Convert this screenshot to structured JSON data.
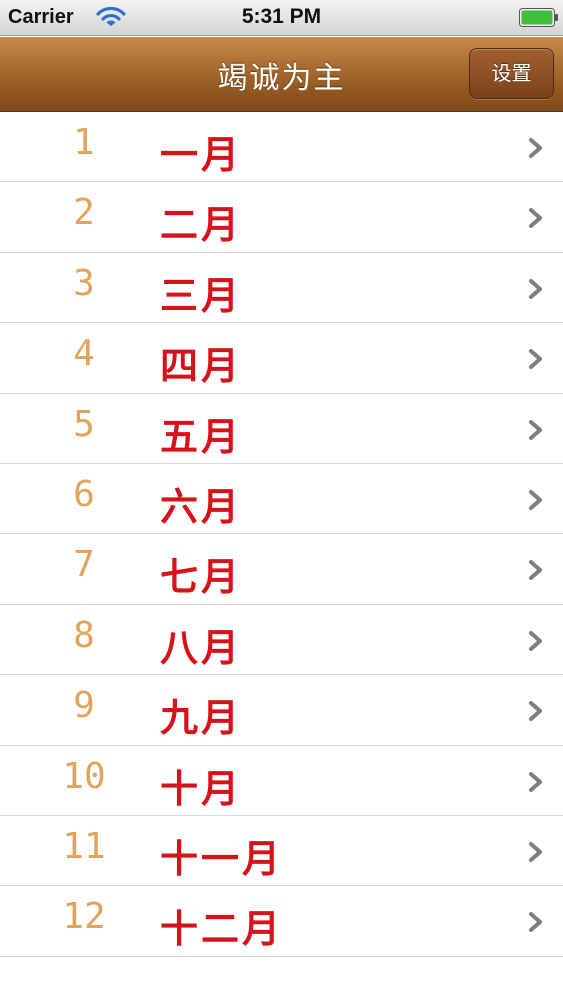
{
  "status_bar": {
    "carrier": "Carrier",
    "time": "5:31 PM"
  },
  "nav": {
    "title": "竭诚为主",
    "settings_label": "设置"
  },
  "colors": {
    "nav_brown": "#a7692e",
    "number_orange": "#e2a35c",
    "month_red": "#d6121a",
    "chevron_gray": "#7d7d7d"
  },
  "months": [
    {
      "num": "1",
      "label": "一月"
    },
    {
      "num": "2",
      "label": "二月"
    },
    {
      "num": "3",
      "label": "三月"
    },
    {
      "num": "4",
      "label": "四月"
    },
    {
      "num": "5",
      "label": "五月"
    },
    {
      "num": "6",
      "label": "六月"
    },
    {
      "num": "7",
      "label": "七月"
    },
    {
      "num": "8",
      "label": "八月"
    },
    {
      "num": "9",
      "label": "九月"
    },
    {
      "num": "10",
      "label": "十月"
    },
    {
      "num": "11",
      "label": "十一月"
    },
    {
      "num": "12",
      "label": "十二月"
    }
  ]
}
